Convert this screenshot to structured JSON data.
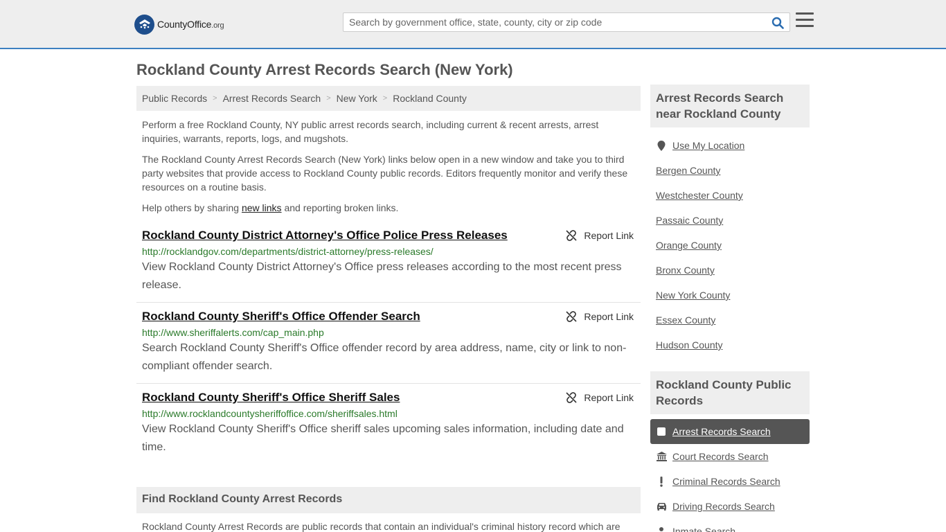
{
  "header": {
    "logo_text": "CountyOffice",
    "logo_suffix": ".org",
    "search_placeholder": "Search by government office, state, county, city or zip code"
  },
  "page_title": "Rockland County Arrest Records Search (New York)",
  "breadcrumb": [
    "Public Records",
    "Arrest Records Search",
    "New York",
    "Rockland County"
  ],
  "intro": {
    "p1": "Perform a free Rockland County, NY public arrest records search, including current & recent arrests, arrest inquiries, warrants, reports, logs, and mugshots.",
    "p2": "The Rockland County Arrest Records Search (New York) links below open in a new window and take you to third party websites that provide access to Rockland County public records. Editors frequently monitor and verify these resources on a routine basis.",
    "p3_before": "Help others by sharing ",
    "p3_link": "new links",
    "p3_after": " and reporting broken links."
  },
  "report_label": "Report Link",
  "records": [
    {
      "title": "Rockland County District Attorney's Office Police Press Releases",
      "url": "http://rocklandgov.com/departments/district-attorney/press-releases/",
      "desc": "View Rockland County District Attorney's Office press releases according to the most recent press release."
    },
    {
      "title": "Rockland County Sheriff's Office Offender Search",
      "url": "http://www.sheriffalerts.com/cap_main.php",
      "desc": "Search Rockland County Sheriff's Office offender record by area address, name, city or link to non-compliant offender search."
    },
    {
      "title": "Rockland County Sheriff's Office Sheriff Sales",
      "url": "http://www.rocklandcountysheriffoffice.com/sheriffsales.html",
      "desc": "View Rockland County Sheriff's Office sheriff sales upcoming sales information, including date and time."
    }
  ],
  "find": {
    "heading": "Find Rockland County Arrest Records",
    "text": "Rockland County Arrest Records are public records that contain an individual's criminal history record which are"
  },
  "sidebar": {
    "nearby_heading": "Arrest Records Search near Rockland County",
    "use_location": "Use My Location",
    "nearby": [
      "Bergen County",
      "Westchester County",
      "Passaic County",
      "Orange County",
      "Bronx County",
      "New York County",
      "Essex County",
      "Hudson County"
    ],
    "public_heading": "Rockland County Public Records",
    "public_items": [
      {
        "label": "Arrest Records Search",
        "icon": "square-icon"
      },
      {
        "label": "Court Records Search",
        "icon": "courthouse-icon"
      },
      {
        "label": "Criminal Records Search",
        "icon": "exclamation-icon"
      },
      {
        "label": "Driving Records Search",
        "icon": "car-icon"
      },
      {
        "label": "Inmate Search",
        "icon": "inmate-icon"
      }
    ]
  },
  "colors": {
    "accent_border": "#3c7fc0",
    "url_green": "#2a7a2a",
    "active_item": "#555555"
  }
}
